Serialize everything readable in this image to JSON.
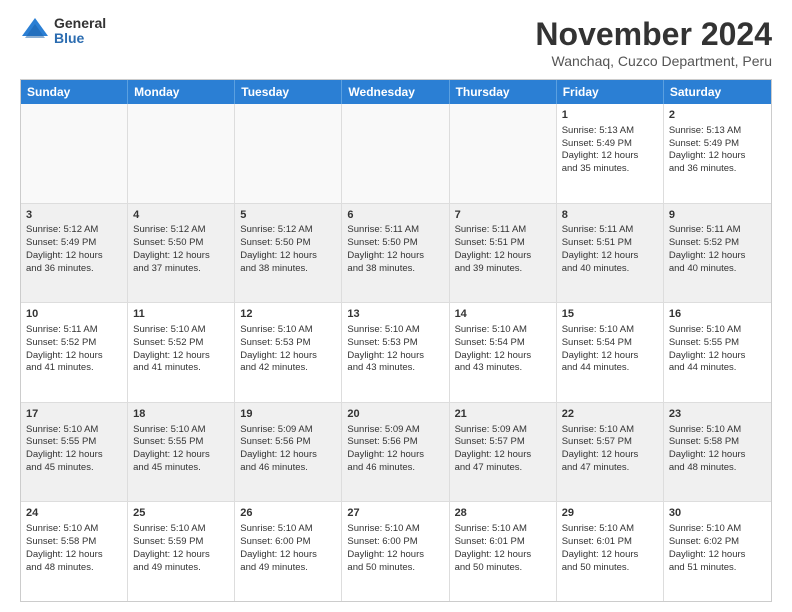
{
  "logo": {
    "general": "General",
    "blue": "Blue"
  },
  "title": "November 2024",
  "subtitle": "Wanchaq, Cuzco Department, Peru",
  "header_days": [
    "Sunday",
    "Monday",
    "Tuesday",
    "Wednesday",
    "Thursday",
    "Friday",
    "Saturday"
  ],
  "weeks": [
    [
      {
        "day": "",
        "content": "",
        "empty": true
      },
      {
        "day": "",
        "content": "",
        "empty": true
      },
      {
        "day": "",
        "content": "",
        "empty": true
      },
      {
        "day": "",
        "content": "",
        "empty": true
      },
      {
        "day": "",
        "content": "",
        "empty": true
      },
      {
        "day": "1",
        "content": "Sunrise: 5:13 AM\nSunset: 5:49 PM\nDaylight: 12 hours\nand 35 minutes.",
        "empty": false
      },
      {
        "day": "2",
        "content": "Sunrise: 5:13 AM\nSunset: 5:49 PM\nDaylight: 12 hours\nand 36 minutes.",
        "empty": false
      }
    ],
    [
      {
        "day": "3",
        "content": "Sunrise: 5:12 AM\nSunset: 5:49 PM\nDaylight: 12 hours\nand 36 minutes.",
        "empty": false
      },
      {
        "day": "4",
        "content": "Sunrise: 5:12 AM\nSunset: 5:50 PM\nDaylight: 12 hours\nand 37 minutes.",
        "empty": false
      },
      {
        "day": "5",
        "content": "Sunrise: 5:12 AM\nSunset: 5:50 PM\nDaylight: 12 hours\nand 38 minutes.",
        "empty": false
      },
      {
        "day": "6",
        "content": "Sunrise: 5:11 AM\nSunset: 5:50 PM\nDaylight: 12 hours\nand 38 minutes.",
        "empty": false
      },
      {
        "day": "7",
        "content": "Sunrise: 5:11 AM\nSunset: 5:51 PM\nDaylight: 12 hours\nand 39 minutes.",
        "empty": false
      },
      {
        "day": "8",
        "content": "Sunrise: 5:11 AM\nSunset: 5:51 PM\nDaylight: 12 hours\nand 40 minutes.",
        "empty": false
      },
      {
        "day": "9",
        "content": "Sunrise: 5:11 AM\nSunset: 5:52 PM\nDaylight: 12 hours\nand 40 minutes.",
        "empty": false
      }
    ],
    [
      {
        "day": "10",
        "content": "Sunrise: 5:11 AM\nSunset: 5:52 PM\nDaylight: 12 hours\nand 41 minutes.",
        "empty": false
      },
      {
        "day": "11",
        "content": "Sunrise: 5:10 AM\nSunset: 5:52 PM\nDaylight: 12 hours\nand 41 minutes.",
        "empty": false
      },
      {
        "day": "12",
        "content": "Sunrise: 5:10 AM\nSunset: 5:53 PM\nDaylight: 12 hours\nand 42 minutes.",
        "empty": false
      },
      {
        "day": "13",
        "content": "Sunrise: 5:10 AM\nSunset: 5:53 PM\nDaylight: 12 hours\nand 43 minutes.",
        "empty": false
      },
      {
        "day": "14",
        "content": "Sunrise: 5:10 AM\nSunset: 5:54 PM\nDaylight: 12 hours\nand 43 minutes.",
        "empty": false
      },
      {
        "day": "15",
        "content": "Sunrise: 5:10 AM\nSunset: 5:54 PM\nDaylight: 12 hours\nand 44 minutes.",
        "empty": false
      },
      {
        "day": "16",
        "content": "Sunrise: 5:10 AM\nSunset: 5:55 PM\nDaylight: 12 hours\nand 44 minutes.",
        "empty": false
      }
    ],
    [
      {
        "day": "17",
        "content": "Sunrise: 5:10 AM\nSunset: 5:55 PM\nDaylight: 12 hours\nand 45 minutes.",
        "empty": false
      },
      {
        "day": "18",
        "content": "Sunrise: 5:10 AM\nSunset: 5:55 PM\nDaylight: 12 hours\nand 45 minutes.",
        "empty": false
      },
      {
        "day": "19",
        "content": "Sunrise: 5:09 AM\nSunset: 5:56 PM\nDaylight: 12 hours\nand 46 minutes.",
        "empty": false
      },
      {
        "day": "20",
        "content": "Sunrise: 5:09 AM\nSunset: 5:56 PM\nDaylight: 12 hours\nand 46 minutes.",
        "empty": false
      },
      {
        "day": "21",
        "content": "Sunrise: 5:09 AM\nSunset: 5:57 PM\nDaylight: 12 hours\nand 47 minutes.",
        "empty": false
      },
      {
        "day": "22",
        "content": "Sunrise: 5:10 AM\nSunset: 5:57 PM\nDaylight: 12 hours\nand 47 minutes.",
        "empty": false
      },
      {
        "day": "23",
        "content": "Sunrise: 5:10 AM\nSunset: 5:58 PM\nDaylight: 12 hours\nand 48 minutes.",
        "empty": false
      }
    ],
    [
      {
        "day": "24",
        "content": "Sunrise: 5:10 AM\nSunset: 5:58 PM\nDaylight: 12 hours\nand 48 minutes.",
        "empty": false
      },
      {
        "day": "25",
        "content": "Sunrise: 5:10 AM\nSunset: 5:59 PM\nDaylight: 12 hours\nand 49 minutes.",
        "empty": false
      },
      {
        "day": "26",
        "content": "Sunrise: 5:10 AM\nSunset: 6:00 PM\nDaylight: 12 hours\nand 49 minutes.",
        "empty": false
      },
      {
        "day": "27",
        "content": "Sunrise: 5:10 AM\nSunset: 6:00 PM\nDaylight: 12 hours\nand 50 minutes.",
        "empty": false
      },
      {
        "day": "28",
        "content": "Sunrise: 5:10 AM\nSunset: 6:01 PM\nDaylight: 12 hours\nand 50 minutes.",
        "empty": false
      },
      {
        "day": "29",
        "content": "Sunrise: 5:10 AM\nSunset: 6:01 PM\nDaylight: 12 hours\nand 50 minutes.",
        "empty": false
      },
      {
        "day": "30",
        "content": "Sunrise: 5:10 AM\nSunset: 6:02 PM\nDaylight: 12 hours\nand 51 minutes.",
        "empty": false
      }
    ]
  ]
}
